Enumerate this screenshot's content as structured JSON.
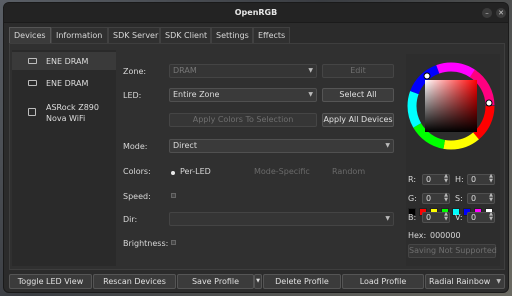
{
  "window": {
    "title": "OpenRGB"
  },
  "tabs": [
    {
      "label": "Devices"
    },
    {
      "label": "Information"
    },
    {
      "label": "SDK Server"
    },
    {
      "label": "SDK Client"
    },
    {
      "label": "Settings"
    },
    {
      "label": "Effects"
    }
  ],
  "devices": [
    {
      "name": "ENE DRAM",
      "icon": "ram-icon"
    },
    {
      "name": "ENE DRAM",
      "icon": "ram-icon"
    },
    {
      "name_line1": "ASRock Z890",
      "name_line2": "Nova WiFi",
      "icon": "motherboard-icon"
    }
  ],
  "controls": {
    "zone_label": "Zone:",
    "zone_value": "DRAM",
    "edit_label": "Edit",
    "led_label": "LED:",
    "led_value": "Entire Zone",
    "select_all_label": "Select All",
    "apply_selection_label": "Apply Colors To Selection",
    "apply_all_label": "Apply All Devices",
    "mode_label": "Mode:",
    "mode_value": "Direct",
    "colors_label": "Colors:",
    "per_led_label": "Per-LED",
    "mode_specific_label": "Mode-Specific",
    "random_label": "Random",
    "speed_label": "Speed:",
    "dir_label": "Dir:",
    "dir_value": "",
    "brightness_label": "Brightness:"
  },
  "color": {
    "r_label": "R:",
    "r": "0",
    "g_label": "G:",
    "g": "0",
    "b_label": "B:",
    "b": "0",
    "h_label": "H:",
    "h": "0",
    "s_label": "S:",
    "s": "0",
    "v_label": "V:",
    "v": "0",
    "hex_label": "Hex:",
    "hex": "000000",
    "saving_label": "Saving Not Supported",
    "swatches": [
      "#000000",
      "#ff0000",
      "#ffff00",
      "#00ff00",
      "#00ffff",
      "#0000ff",
      "#ff00ff",
      "#ffffff"
    ]
  },
  "bottom": {
    "toggle_led_view": "Toggle LED View",
    "rescan_devices": "Rescan Devices",
    "save_profile": "Save Profile",
    "delete_profile": "Delete Profile",
    "load_profile": "Load Profile",
    "effect_selected": "Radial Rainbow"
  }
}
